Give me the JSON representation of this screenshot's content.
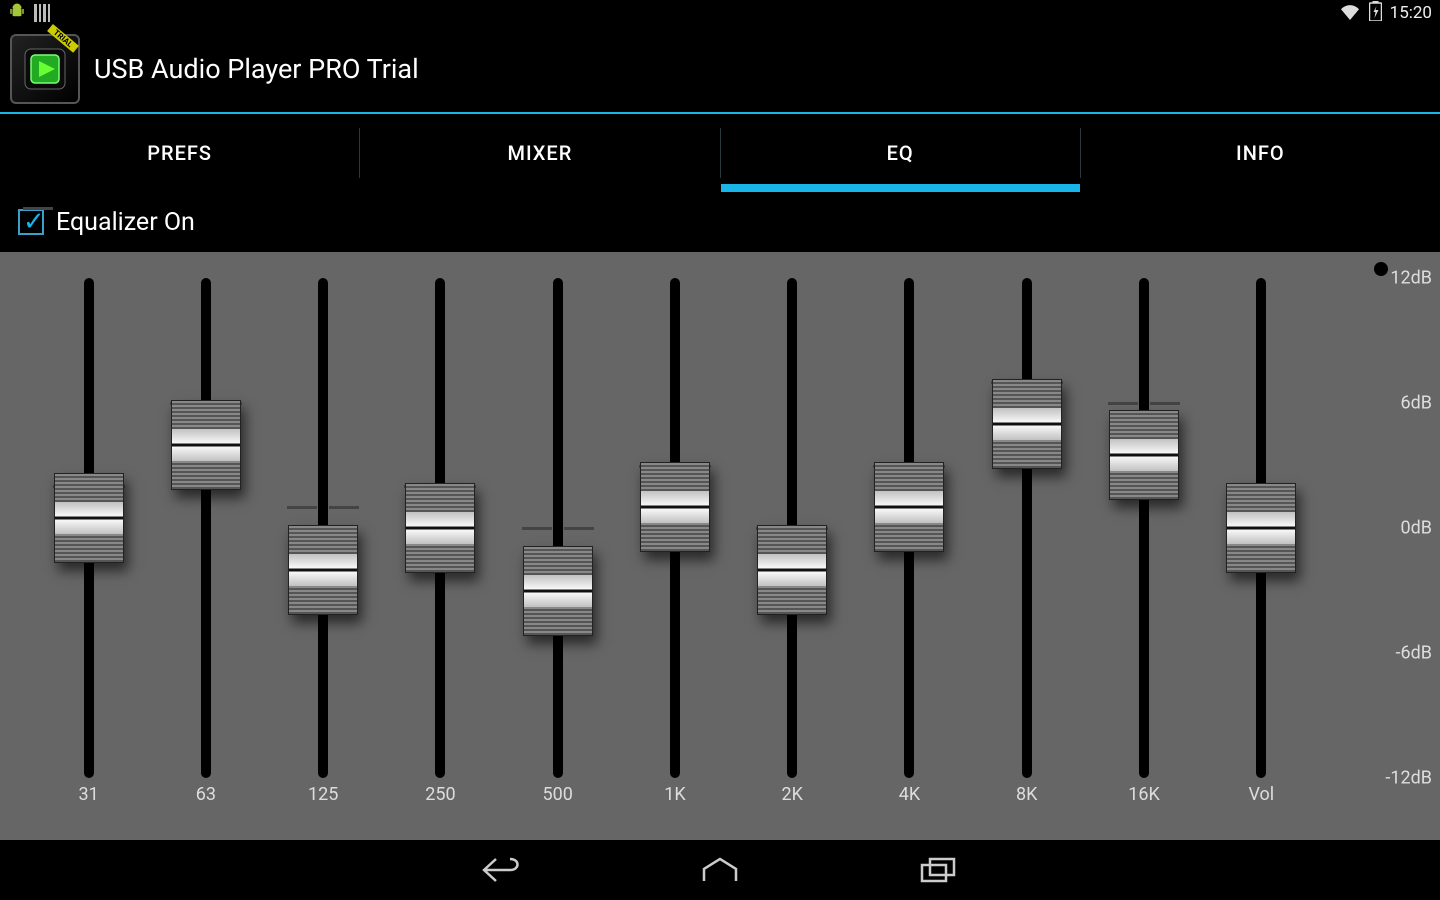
{
  "status": {
    "time": "15:20"
  },
  "app": {
    "title": "USB Audio Player PRO Trial"
  },
  "tabs": {
    "items": [
      {
        "label": "PREFS",
        "active": false
      },
      {
        "label": "MIXER",
        "active": false
      },
      {
        "label": "EQ",
        "active": true
      },
      {
        "label": "INFO",
        "active": false
      }
    ]
  },
  "eq": {
    "toggle_label": "Equalizer On",
    "toggle_checked": true,
    "db_min": -12,
    "db_max": 12,
    "db_labels": [
      "12dB",
      "6dB",
      "0dB",
      "-6dB",
      "-12dB"
    ],
    "vol_label": "Vol",
    "bands": [
      {
        "freq": "31",
        "tick_db": 2,
        "value_db": 0.5
      },
      {
        "freq": "63",
        "tick_db": 6,
        "value_db": 4
      },
      {
        "freq": "125",
        "tick_db": 1,
        "value_db": -2
      },
      {
        "freq": "250",
        "tick_db": 2,
        "value_db": 0
      },
      {
        "freq": "500",
        "tick_db": 0,
        "value_db": -3
      },
      {
        "freq": "1K",
        "tick_db": 3,
        "value_db": 1
      },
      {
        "freq": "2K",
        "tick_db": 0,
        "value_db": -2
      },
      {
        "freq": "4K",
        "tick_db": 3,
        "value_db": 1
      },
      {
        "freq": "8K",
        "tick_db": 7,
        "value_db": 5
      },
      {
        "freq": "16K",
        "tick_db": 6,
        "value_db": 3.5
      }
    ],
    "volume": {
      "value_db": 0
    }
  }
}
